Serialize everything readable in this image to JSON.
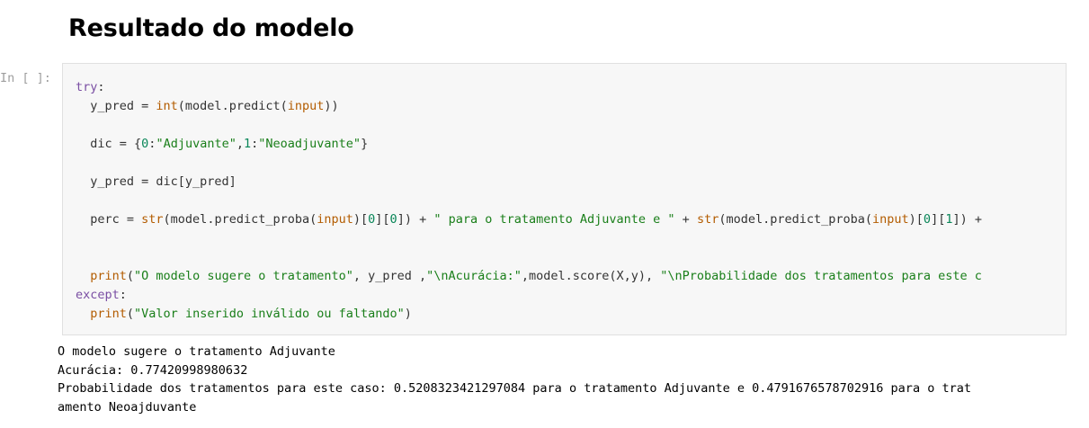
{
  "markdown": {
    "heading": "Resultado do modelo"
  },
  "cell": {
    "prompt": "In [ ]:",
    "code_lines": [
      [
        {
          "t": "try",
          "c": "k"
        },
        {
          "t": ":",
          "c": ""
        }
      ],
      [
        {
          "t": "  y_pred = ",
          "c": ""
        },
        {
          "t": "int",
          "c": "b"
        },
        {
          "t": "(model.predict(",
          "c": ""
        },
        {
          "t": "input",
          "c": "b"
        },
        {
          "t": "))",
          "c": ""
        }
      ],
      [],
      [
        {
          "t": "  dic = {",
          "c": ""
        },
        {
          "t": "0",
          "c": "n"
        },
        {
          "t": ":",
          "c": ""
        },
        {
          "t": "\"Adjuvante\"",
          "c": "s"
        },
        {
          "t": ",",
          "c": ""
        },
        {
          "t": "1",
          "c": "n"
        },
        {
          "t": ":",
          "c": ""
        },
        {
          "t": "\"Neoadjuvante\"",
          "c": "s"
        },
        {
          "t": "}",
          "c": ""
        }
      ],
      [],
      [
        {
          "t": "  y_pred = dic[y_pred]",
          "c": ""
        }
      ],
      [],
      [
        {
          "t": "  perc = ",
          "c": ""
        },
        {
          "t": "str",
          "c": "b"
        },
        {
          "t": "(model.predict_proba(",
          "c": ""
        },
        {
          "t": "input",
          "c": "b"
        },
        {
          "t": ")[",
          "c": ""
        },
        {
          "t": "0",
          "c": "n"
        },
        {
          "t": "][",
          "c": ""
        },
        {
          "t": "0",
          "c": "n"
        },
        {
          "t": "]) + ",
          "c": ""
        },
        {
          "t": "\" para o tratamento Adjuvante e \"",
          "c": "s"
        },
        {
          "t": " + ",
          "c": ""
        },
        {
          "t": "str",
          "c": "b"
        },
        {
          "t": "(model.predict_proba(",
          "c": ""
        },
        {
          "t": "input",
          "c": "b"
        },
        {
          "t": ")[",
          "c": ""
        },
        {
          "t": "0",
          "c": "n"
        },
        {
          "t": "][",
          "c": ""
        },
        {
          "t": "1",
          "c": "n"
        },
        {
          "t": "]) +",
          "c": ""
        }
      ],
      [],
      [],
      [
        {
          "t": "  print",
          "c": "b"
        },
        {
          "t": "(",
          "c": ""
        },
        {
          "t": "\"O modelo sugere o tratamento\"",
          "c": "s"
        },
        {
          "t": ", y_pred ,",
          "c": ""
        },
        {
          "t": "\"\\nAcurácia:\"",
          "c": "s"
        },
        {
          "t": ",model.score(X,y), ",
          "c": ""
        },
        {
          "t": "\"\\nProbabilidade dos tratamentos para este c",
          "c": "s"
        }
      ],
      [
        {
          "t": "except",
          "c": "k"
        },
        {
          "t": ":",
          "c": ""
        }
      ],
      [
        {
          "t": "  print",
          "c": "b"
        },
        {
          "t": "(",
          "c": ""
        },
        {
          "t": "\"Valor inserido inválido ou faltando\"",
          "c": "s"
        },
        {
          "t": ")",
          "c": ""
        }
      ]
    ]
  },
  "output": {
    "lines": [
      "O modelo sugere o tratamento Adjuvante",
      "Acurácia: 0.77420998980632",
      "Probabilidade dos tratamentos para este caso: 0.5208323421297084 para o tratamento Adjuvante e 0.4791676578702916 para o trat",
      "amento Neoajduvante"
    ]
  }
}
